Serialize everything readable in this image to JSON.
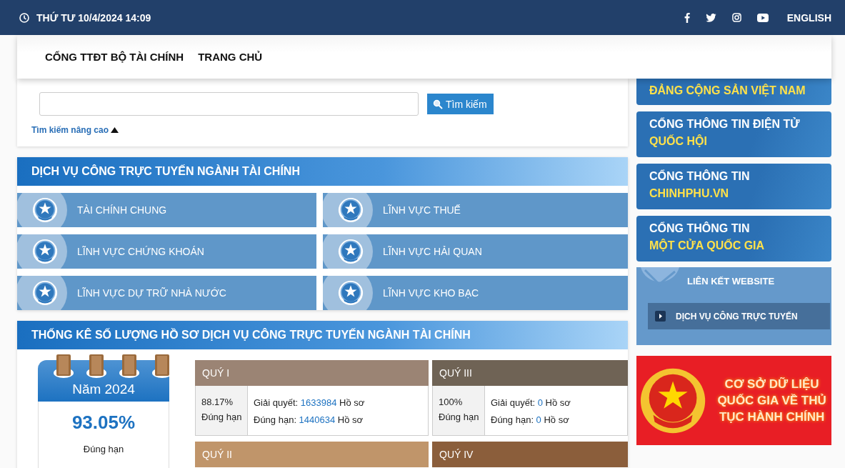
{
  "top_bar": {
    "datetime": "THỨ TƯ 10/4/2024 14:09",
    "language": "ENGLISH"
  },
  "nav": {
    "items": [
      "CỔNG TTĐT BỘ TÀI CHÍNH",
      "TRANG CHỦ"
    ]
  },
  "search": {
    "button": "Tìm kiếm",
    "advanced_link": "Tìm kiếm nâng cao"
  },
  "services": {
    "title": "DỊCH VỤ CÔNG TRỰC TUYẾN NGÀNH TÀI CHÍNH",
    "items": [
      "TÀI CHÍNH CHUNG",
      "LĨNH VỰC THUẾ",
      "LĨNH VỰC CHỨNG KHOÁN",
      "LĨNH VỰC HẢI QUAN",
      "LĨNH VỰC DỰ TRỮ NHÀ NƯỚC",
      "LĨNH VỰC KHO BẠC"
    ]
  },
  "statistics": {
    "title": "THỐNG KÊ SỐ LƯỢNG HỒ SƠ DỊCH VỤ CÔNG TRỰC TUYẾN NGÀNH TÀI CHÍNH",
    "year": {
      "label": "Năm 2024",
      "percent": "93.05%",
      "caption": "Đúng hạn"
    },
    "quarters": [
      {
        "title": "QUÝ I",
        "color": "#9b8474",
        "percent": "88.17%",
        "percent_caption": "Đúng hạn",
        "resolved_label": "Giải quyết:",
        "resolved": "1633984",
        "resolved_unit": "Hồ sơ",
        "on_time_label": "Đúng hạn:",
        "on_time": "1440634",
        "on_time_unit": "Hồ sơ"
      },
      {
        "title": "QUÝ III",
        "color": "#6f6355",
        "percent": "100%",
        "percent_caption": "Đúng hạn",
        "resolved_label": "Giải quyết:",
        "resolved": "0",
        "resolved_unit": "Hồ sơ",
        "on_time_label": "Đúng hạn:",
        "on_time": "0",
        "on_time_unit": "Hồ sơ"
      },
      {
        "title": "QUÝ II",
        "color": "#c0956a"
      },
      {
        "title": "QUÝ IV",
        "color": "#8b5e3b"
      }
    ]
  },
  "portals": [
    {
      "highlight": "ĐẢNG CỘNG SẢN VIỆT NAM"
    },
    {
      "title": "CỔNG THÔNG TIN ĐIỆN TỬ",
      "highlight": "QUỐC HỘI"
    },
    {
      "title": "CỔNG THÔNG TIN",
      "highlight": "CHINHPHU.VN"
    },
    {
      "title": "CỔNG THÔNG TIN",
      "highlight": "MỘT CỬA QUỐC GIA"
    }
  ],
  "links": {
    "title": "LIÊN KẾT WEBSITE",
    "items": [
      "DỊCH VỤ CÔNG TRỰC TUYẾN"
    ]
  },
  "banner": {
    "text": "CƠ SỞ DỮ LIỆU QUỐC GIA VỀ THỦ TỤC HÀNH CHÍNH"
  }
}
